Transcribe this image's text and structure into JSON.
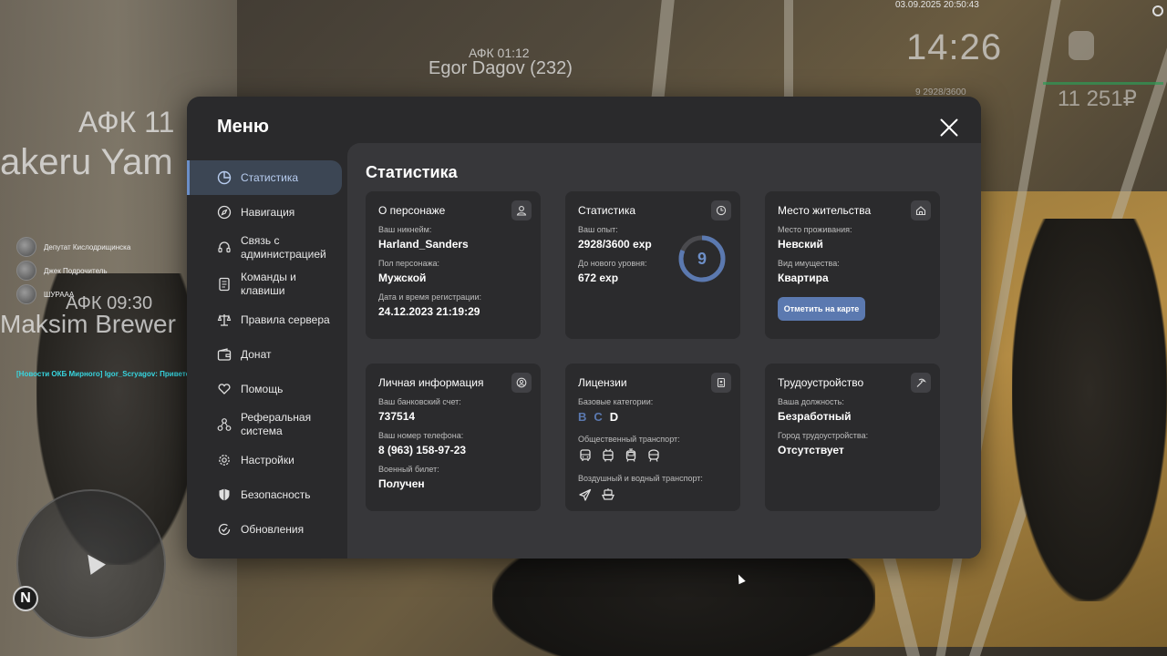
{
  "hud": {
    "datetime": "03.09.2025 20:50:43",
    "clock": "14:26",
    "exp_readout": "9  2928/3600",
    "money": "11 251₽"
  },
  "nametags": {
    "afk1": "АФК 01:12",
    "name1": "Egor Dagov (232)",
    "afk2": "АФК 11",
    "name2": "akeru Yam",
    "afk3": "АФК 09:30",
    "name3": "Maksim Brewer"
  },
  "voice": [
    {
      "name": "Депутат Кислодрищинска"
    },
    {
      "name": "Джек Подрочитель"
    },
    {
      "name": "ШУРААА"
    }
  ],
  "chat": {
    "line": "[Новости ОКБ Мирного] Igor_Scryagov: Приветствуем Вас, уважаемые граждане Провинции!"
  },
  "minimap": {
    "north": "N"
  },
  "menu": {
    "title": "Меню",
    "sidebar": [
      {
        "label": "Статистика",
        "icon": "pie-chart-icon",
        "active": true
      },
      {
        "label": "Навигация",
        "icon": "compass-icon"
      },
      {
        "label": "Связь с администрацией",
        "icon": "headset-icon"
      },
      {
        "label": "Команды и клавиши",
        "icon": "document-icon"
      },
      {
        "label": "Правила сервера",
        "icon": "scales-icon"
      },
      {
        "label": "Донат",
        "icon": "wallet-icon"
      },
      {
        "label": "Помощь",
        "icon": "heart-hands-icon"
      },
      {
        "label": "Реферальная система",
        "icon": "referral-icon"
      },
      {
        "label": "Настройки",
        "icon": "gear-icon"
      },
      {
        "label": "Безопасность",
        "icon": "shield-icon"
      },
      {
        "label": "Обновления",
        "icon": "refresh-check-icon"
      }
    ],
    "content_title": "Статистика",
    "cards": {
      "character": {
        "title": "О персонаже",
        "nickname_label": "Ваш никнейм:",
        "nickname": "Harland_Sanders",
        "gender_label": "Пол персонажа:",
        "gender": "Мужской",
        "reg_label": "Дата и время регистрации:",
        "reg_value": "24.12.2023 21:19:29"
      },
      "stats": {
        "title": "Статистика",
        "exp_label": "Ваш опыт:",
        "exp_value": "2928/3600 exp",
        "next_label": "До нового уровня:",
        "next_value": "672 exp",
        "level": "9",
        "level_progress": 0.813
      },
      "residence": {
        "title": "Место жительства",
        "place_label": "Место проживания:",
        "place": "Невский",
        "property_label": "Вид имущества:",
        "property": "Квартира",
        "map_button": "Отметить на карте"
      },
      "personal": {
        "title": "Личная информация",
        "bank_label": "Ваш банковский счет:",
        "bank": "737514",
        "phone_label": "Ваш номер телефона:",
        "phone": "8 (963) 158-97-23",
        "military_label": "Военный билет:",
        "military": "Получен"
      },
      "licenses": {
        "title": "Лицензии",
        "base_label": "Базовые категории:",
        "categories": [
          {
            "letter": "B",
            "color": "#5b79b0"
          },
          {
            "letter": "C",
            "color": "#5b79b0"
          },
          {
            "letter": "D",
            "color": "#ffffff"
          }
        ],
        "public_label": "Общественный транспорт:",
        "public_icons": [
          "bus-icon",
          "trolleybus-icon",
          "tram-icon",
          "metro-icon"
        ],
        "air_label": "Воздушный и водный транспорт:",
        "air_icons": [
          "plane-icon",
          "boat-icon"
        ]
      },
      "employment": {
        "title": "Трудоустройство",
        "position_label": "Ваша должность:",
        "position": "Безработный",
        "city_label": "Город трудоустройства:",
        "city": "Отсутствует"
      }
    }
  }
}
